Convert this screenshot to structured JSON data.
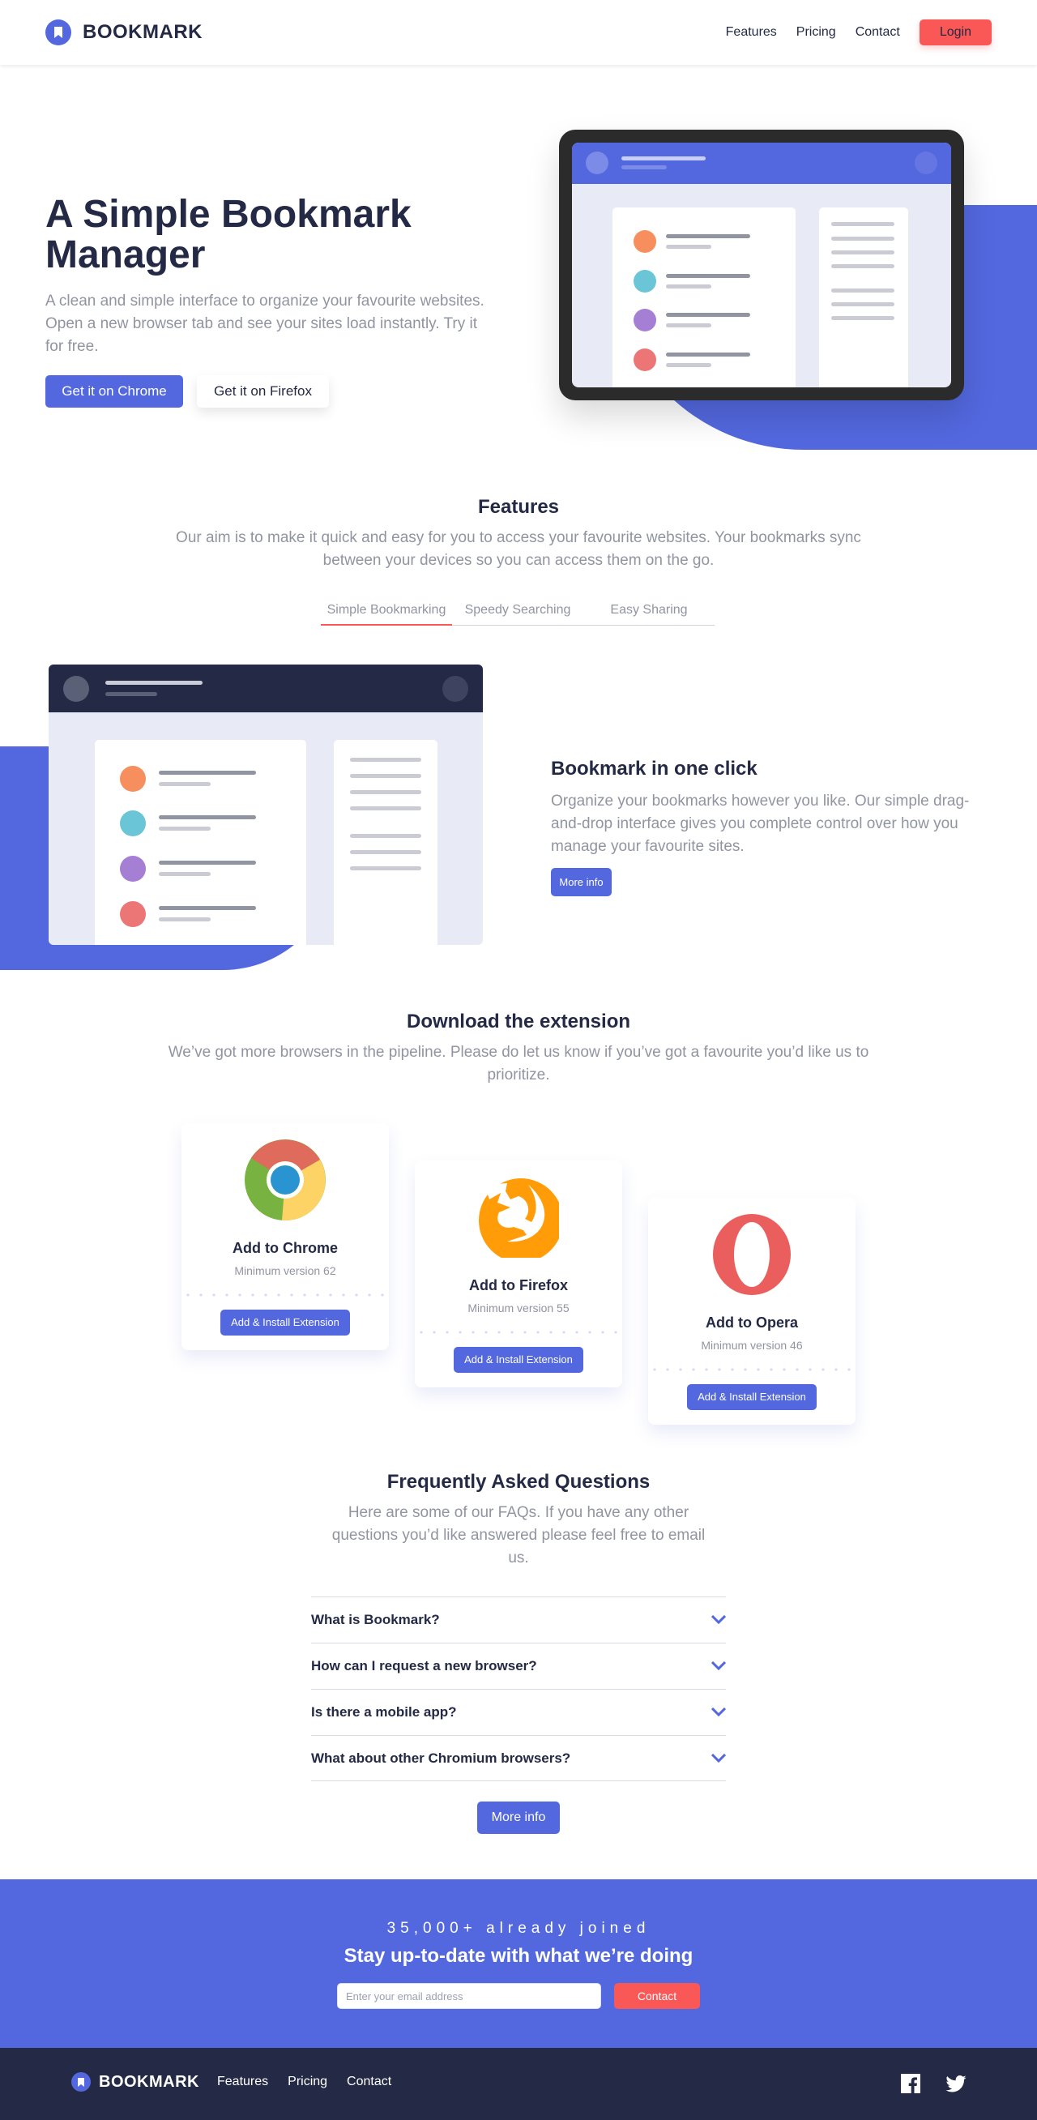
{
  "header": {
    "brand": "BOOKMARK",
    "nav": [
      {
        "label": "Features"
      },
      {
        "label": "Pricing"
      },
      {
        "label": "Contact"
      }
    ],
    "login_label": "Login"
  },
  "hero": {
    "title": "A Simple Bookmark Manager",
    "subtitle": "A clean and simple interface to organize your favourite websites. Open a new browser tab and see your sites load instantly. Try it for free.",
    "chrome_button": "Get it on Chrome",
    "firefox_button": "Get it on Firefox"
  },
  "features": {
    "title": "Features",
    "subtitle": "Our aim is to make it quick and easy for you to access your favourite websites. Your bookmarks sync between your devices so you can access them on the go.",
    "tabs": [
      {
        "label": "Simple Bookmarking",
        "active": true
      },
      {
        "label": "Speedy Searching",
        "active": false
      },
      {
        "label": "Easy Sharing",
        "active": false
      }
    ],
    "panel": {
      "title": "Bookmark in one click",
      "text": "Organize your bookmarks however you like. Our simple drag-and-drop interface gives you complete control over how you manage your favourite sites.",
      "button": "More info"
    }
  },
  "download": {
    "title": "Download the extension",
    "subtitle": "We’ve got more browsers in the pipeline. Please do let us know if you’ve got a favourite you’d like us to prioritize.",
    "cards": [
      {
        "name": "Add to Chrome",
        "version": "Minimum version 62",
        "button": "Add & Install Extension",
        "icon": "chrome-logo"
      },
      {
        "name": "Add to Firefox",
        "version": "Minimum version 55",
        "button": "Add & Install Extension",
        "icon": "firefox-logo"
      },
      {
        "name": "Add to Opera",
        "version": "Minimum version 46",
        "button": "Add & Install Extension",
        "icon": "opera-logo"
      }
    ]
  },
  "faq": {
    "title": "Frequently Asked Questions",
    "subtitle": "Here are some of our FAQs. If you have any other questions you’d like answered please feel free to email us.",
    "items": [
      {
        "question": "What is Bookmark?"
      },
      {
        "question": "How can I request a new browser?"
      },
      {
        "question": "Is there a mobile app?"
      },
      {
        "question": "What about other Chromium browsers?"
      }
    ],
    "button": "More info"
  },
  "cta": {
    "count": "35,000+ already joined",
    "title": "Stay up-to-date with what we’re doing",
    "email_placeholder": "Enter your email address",
    "email_value": "",
    "button": "Contact"
  },
  "footer": {
    "brand": "BOOKMARK",
    "nav": [
      {
        "label": "Features"
      },
      {
        "label": "Pricing"
      },
      {
        "label": "Contact"
      }
    ],
    "social": [
      "facebook-icon",
      "twitter-icon"
    ]
  },
  "colors": {
    "primary": "#5368df",
    "accent": "#fa5757",
    "dark": "#242a45",
    "muted": "#9194a1"
  }
}
